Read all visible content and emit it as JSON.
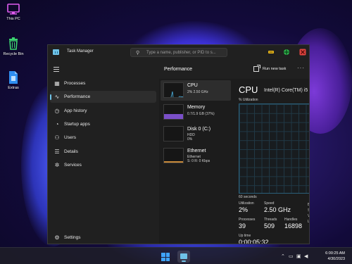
{
  "desktop": {
    "icons": [
      {
        "label": "This PC",
        "icon": "monitor-icon"
      },
      {
        "label": "Recycle Bin",
        "icon": "recycle-bin-icon"
      },
      {
        "label": "Extras",
        "icon": "file-icon"
      }
    ]
  },
  "window": {
    "title": "Task Manager",
    "search_placeholder": "Type a name, publisher, or PID to s...",
    "controls": [
      "minimize-icon",
      "maximize-icon",
      "close-icon"
    ]
  },
  "sidebar": {
    "items": [
      {
        "label": "Processes",
        "icon": "processes-icon"
      },
      {
        "label": "Performance",
        "icon": "performance-icon",
        "active": true
      },
      {
        "label": "App history",
        "icon": "history-icon"
      },
      {
        "label": "Startup apps",
        "icon": "startup-icon"
      },
      {
        "label": "Users",
        "icon": "users-icon"
      },
      {
        "label": "Details",
        "icon": "details-icon"
      },
      {
        "label": "Services",
        "icon": "services-icon"
      }
    ],
    "settings_label": "Settings"
  },
  "main": {
    "title": "Performance",
    "run_new_task": "Run new task",
    "more": "···"
  },
  "resources": [
    {
      "name": "CPU",
      "line1": "2% 2.50 GHz",
      "line2": ""
    },
    {
      "name": "Memory",
      "line1": "0.7/1.9 GB (37%)",
      "line2": ""
    },
    {
      "name": "Disk 0 (C:)",
      "line1": "HDD",
      "line2": "0%"
    },
    {
      "name": "Ethernet",
      "line1": "Ethernet",
      "line2": "S: 0 R: 0 Kbps"
    }
  ],
  "detail": {
    "title": "CPU",
    "model": "Intel(R) Core(TM) i5",
    "y_label": "% Utilization",
    "x_label": "60 seconds",
    "utilization_label": "Utilization",
    "utilization_value": "2%",
    "speed_label": "Speed",
    "speed_value": "2.50 GHz",
    "processes_label": "Processes",
    "processes_value": "39",
    "threads_label": "Threads",
    "threads_value": "509",
    "handles_label": "Handles",
    "handles_value": "16898",
    "uptime_label": "Up time",
    "uptime_value": "0:00:05:32",
    "edge_letters": [
      "B",
      "S",
      "V",
      "L"
    ]
  },
  "taskbar": {
    "time": "6:00:25 AM",
    "date": "4/30/2023"
  },
  "colors": {
    "accent": "#6fc3e8",
    "window_bg": "#202020",
    "minimize": "#e8b71c",
    "maximize": "#2fb24c",
    "close": "#e0453f"
  }
}
